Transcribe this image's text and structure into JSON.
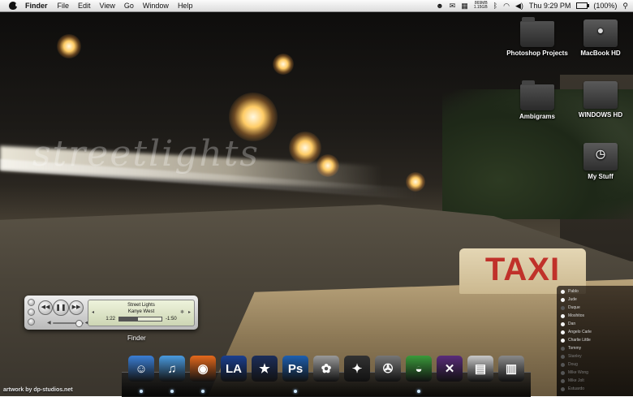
{
  "menubar": {
    "app_name": "Finder",
    "items": [
      "File",
      "Edit",
      "View",
      "Go",
      "Window",
      "Help"
    ],
    "memory_top": "869MB",
    "memory_bottom": "1.15GB",
    "clock": "Thu 9:29 PM",
    "battery": "(100%)"
  },
  "desktop": {
    "icons": [
      {
        "label": "Photoshop Projects",
        "kind": "folder"
      },
      {
        "label": "MacBook HD",
        "kind": "drive"
      },
      {
        "label": "Ambigrams",
        "kind": "folder"
      },
      {
        "label": "WINDOWS HD",
        "kind": "drive"
      },
      {
        "label": "My Stuff",
        "kind": "drive"
      }
    ]
  },
  "wallpaper": {
    "overlay_text": "streetlights",
    "sign_text": "TAXI"
  },
  "player": {
    "track": "Street Lights",
    "artist": "Kanye West",
    "elapsed": "1:22",
    "remaining": "-1:50",
    "progress": 0.45,
    "volume": 0.85
  },
  "dock": {
    "hover_label": "Finder",
    "items": [
      {
        "name": "finder-icon",
        "glyph": "☺",
        "color": "#3b7fd6",
        "running": true
      },
      {
        "name": "itunes-icon",
        "glyph": "♫",
        "color": "#4a9be0",
        "running": true
      },
      {
        "name": "firefox-icon",
        "glyph": "◉",
        "color": "#e5691c",
        "running": true
      },
      {
        "name": "dodgers-icon",
        "glyph": "LA",
        "color": "#1a3f8f",
        "running": false
      },
      {
        "name": "cowboys-star-icon",
        "glyph": "★",
        "color": "#1c2e5a",
        "running": false
      },
      {
        "name": "photoshop-icon",
        "glyph": "Ps",
        "color": "#1d5fb0",
        "running": true
      },
      {
        "name": "bunny-icon",
        "glyph": "✿",
        "color": "#9a9a9a",
        "running": false
      },
      {
        "name": "crow-icon",
        "glyph": "✦",
        "color": "#333333",
        "running": false
      },
      {
        "name": "system-prefs-icon",
        "glyph": "✇",
        "color": "#777777",
        "running": false
      },
      {
        "name": "adium-duck-icon",
        "glyph": "◒",
        "color": "#3a9a3a",
        "running": true
      },
      {
        "name": "front-row-icon",
        "glyph": "✕",
        "color": "#5a2c7a",
        "running": false
      },
      {
        "name": "browser-window-icon",
        "glyph": "▤",
        "color": "#c9c9c9",
        "running": false
      },
      {
        "name": "trash-icon",
        "glyph": "▥",
        "color": "#8a8a8a",
        "running": false
      }
    ]
  },
  "buddy_list": {
    "rows": [
      {
        "name": "Pablo",
        "status": "online"
      },
      {
        "name": "Jude",
        "status": "online"
      },
      {
        "name": "Duque",
        "status": "away"
      },
      {
        "name": "Moshitos",
        "status": "online"
      },
      {
        "name": "Dan",
        "status": "online"
      },
      {
        "name": "Angelo Carle",
        "status": "online"
      },
      {
        "name": "Charlie Little",
        "status": "online"
      },
      {
        "name": "Tommy",
        "status": "away"
      },
      {
        "name": "Stanley",
        "status": "idle"
      },
      {
        "name": "Doug",
        "status": "idle"
      },
      {
        "name": "Mike Wong",
        "status": "idle"
      },
      {
        "name": "Mike Jolt",
        "status": "idle"
      },
      {
        "name": "Estuardo",
        "status": "idle"
      }
    ]
  },
  "credit": "artwork by dp-studios.net"
}
